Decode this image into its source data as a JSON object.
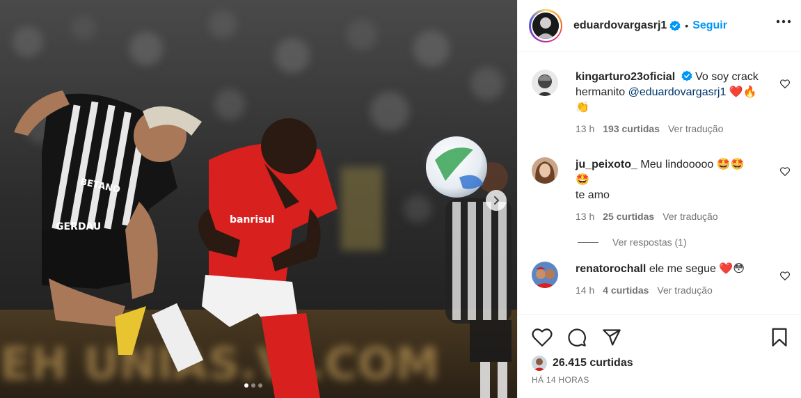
{
  "post": {
    "username": "eduardovargasrj1",
    "follow_label": "Seguir",
    "separator": "•"
  },
  "comments": [
    {
      "username": "kingarturo23oficial",
      "text": "Vo soy crack hermanito",
      "mention": "@eduardovargasrj1",
      "emojis": "❤️🔥",
      "emoji_line2": "👏",
      "time": "13 h",
      "likes": "193 curtidas",
      "translate": "Ver tradução",
      "verified": true
    },
    {
      "username": "ju_peixoto_",
      "text": "Meu lindooooo",
      "emojis": "🤩🤩",
      "emoji_line2": "🤩",
      "text_line3": "te amo",
      "time": "13 h",
      "likes": "25 curtidas",
      "translate": "Ver tradução",
      "replies": "Ver respostas (1)"
    },
    {
      "username": "renatorochall",
      "text": "ele me segue",
      "emojis": "❤️😳",
      "time": "14 h",
      "likes": "4 curtidas",
      "translate": "Ver tradução"
    }
  ],
  "footer": {
    "likes_total": "26.415 curtidas",
    "timestamp": "HÁ 14 HORAS"
  },
  "media": {
    "carousel_dots": 3,
    "active_dot": 0
  },
  "colors": {
    "accent": "#0095f6",
    "verified": "#0095f6",
    "text": "#262626",
    "secondary": "#737373"
  }
}
